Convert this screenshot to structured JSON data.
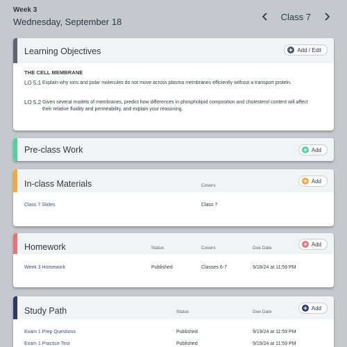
{
  "header": {
    "week": "Week 3",
    "date": "Wednesday, September 18",
    "class_label": "Class 7"
  },
  "objectives": {
    "title": "Learning Objectives",
    "add_label": "Add / Edit",
    "heading": "THE CELL MEMBRANE",
    "items": [
      {
        "num": "LO 5.1",
        "text": "Explain why ions and polar molecules do not move across plasma membranes efficiently without a transport protein."
      },
      {
        "num": "LO 5.2",
        "text": "Given several models of membranes, predict how differences in phospholipid composition and cholesterol content will affect their relative fluidity and permeability, and explain your reasoning."
      }
    ]
  },
  "preclass": {
    "title": "Pre-class Work",
    "add_label": "Add"
  },
  "inclass": {
    "title": "In-class Materials",
    "add_label": "Add",
    "col_covers": "Covers",
    "rows": [
      {
        "name": "Class 7 Slides",
        "covers": "Class 7"
      }
    ]
  },
  "homework": {
    "title": "Homework",
    "add_label": "Add",
    "col_status": "Status",
    "col_covers": "Covers",
    "col_due": "Due Date",
    "rows": [
      {
        "name": "Week 3 Homework",
        "status": "Published",
        "covers": "Classes 6-7",
        "due": "9/18/24 at 11:59 PM"
      }
    ]
  },
  "studypath": {
    "title": "Study Path",
    "add_label": "Add",
    "col_status": "Status",
    "col_due": "Due Date",
    "rows": [
      {
        "name": "Exam 1 Prep Questions",
        "status": "Published",
        "due": "9/19/24 at 11:59 PM"
      },
      {
        "name": "Exam 1 Practice Test",
        "status": "Published",
        "due": "9/19/24 at 11:59 PM"
      }
    ]
  },
  "colors": {
    "objectives_accent": "#5d6470",
    "preclass_accent": "#4fd39a",
    "inclass_accent": "#f2a93b",
    "homework_accent": "#e57373",
    "studypath_accent": "#2b3a67"
  },
  "icons": [
    "chevron-left-icon",
    "chevron-right-icon",
    "plus-circle-icon"
  ]
}
